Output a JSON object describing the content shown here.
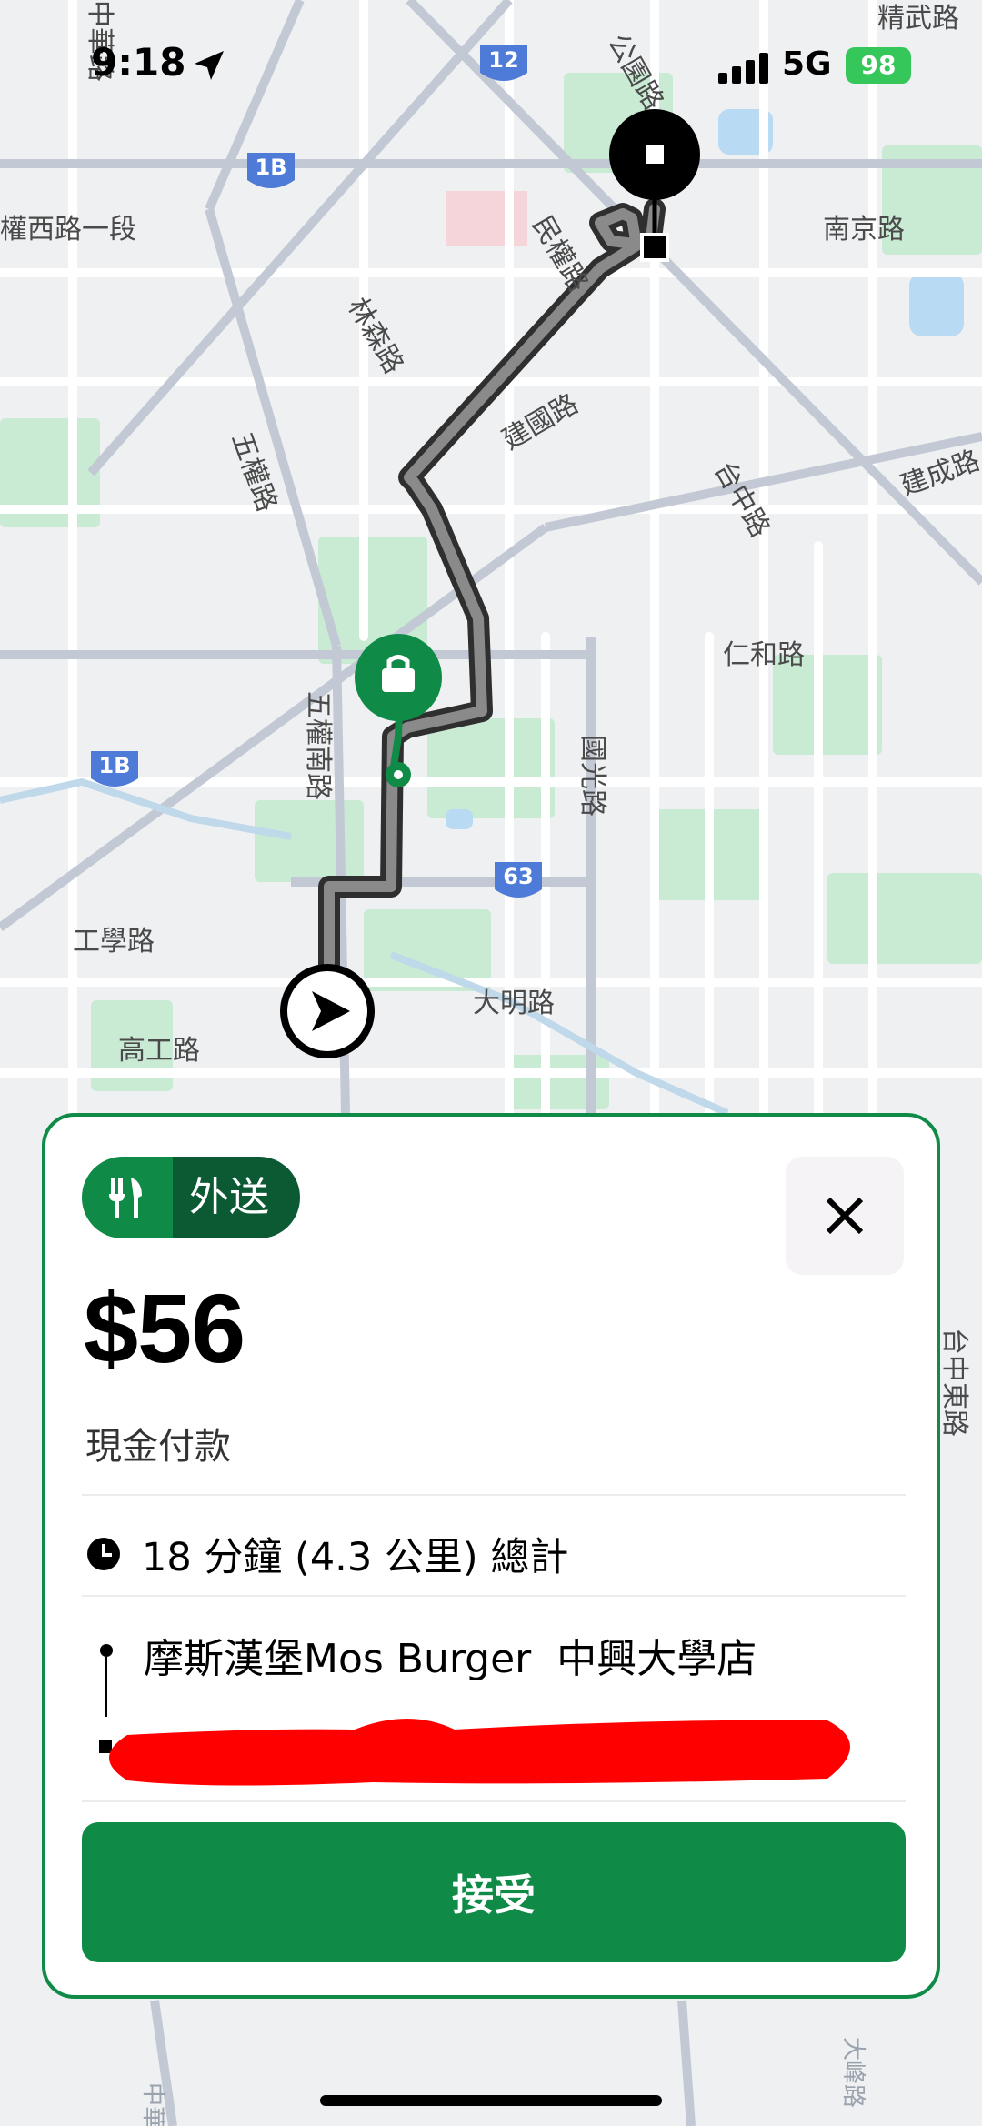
{
  "status": {
    "time": "9:18",
    "network": "5G",
    "battery": "98"
  },
  "map": {
    "roads": [
      "權西路一段",
      "南京路",
      "林森路",
      "五權路",
      "建國路",
      "台中路",
      "建成路",
      "仁和路",
      "五權南路",
      "國光路",
      "工學路",
      "高工路",
      "大明路",
      "民權路",
      "公園路",
      "精武路",
      "台中東路",
      "大峰路",
      "中華路"
    ],
    "shields": [
      "12",
      "1B",
      "1B",
      "63"
    ]
  },
  "card": {
    "badge_label": "外送",
    "fare": "$56",
    "payment": "現金付款",
    "trip_summary": "18 分鐘 (4.3 公里) 總計",
    "pickup": "摩斯漢堡Mos Burger  中興大學店",
    "accept_label": "接受"
  }
}
